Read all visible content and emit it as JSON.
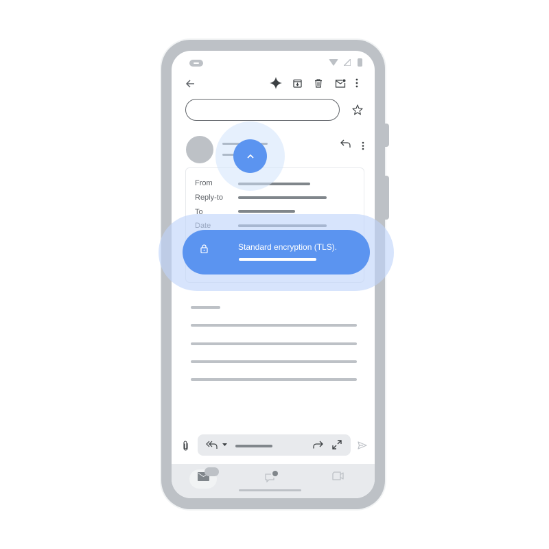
{
  "toolbar": {
    "back": "arrow-back-icon",
    "actions": [
      "sparkle-icon",
      "archive-icon",
      "delete-icon",
      "mark-unread-icon",
      "more-vert-icon"
    ]
  },
  "subject": {
    "star": "star-outline-icon"
  },
  "message_header": {
    "actions": [
      "reply-icon",
      "more-vert-icon"
    ],
    "expand_button": "chevron-up-icon"
  },
  "details": {
    "rows": [
      {
        "label": "From"
      },
      {
        "label": "Reply-to"
      },
      {
        "label": "To"
      },
      {
        "label": "Date"
      }
    ]
  },
  "security": {
    "icon": "lock-icon",
    "text": "Standard encryption (TLS)."
  },
  "compose_bar": {
    "attach": "attach-icon",
    "reply_all": "reply-all-icon",
    "dropdown": "dropdown-arrow-icon",
    "forward": "forward-icon",
    "expand": "expand-icon",
    "send": "send-icon"
  },
  "bottom_nav": {
    "items": [
      "mail-icon",
      "chat-icon",
      "meet-icon"
    ]
  },
  "colors": {
    "accent": "#5b94f0",
    "halo": "#d2e3fc",
    "frame": "#bdc1c6",
    "placeholder_line": "#80868b"
  }
}
